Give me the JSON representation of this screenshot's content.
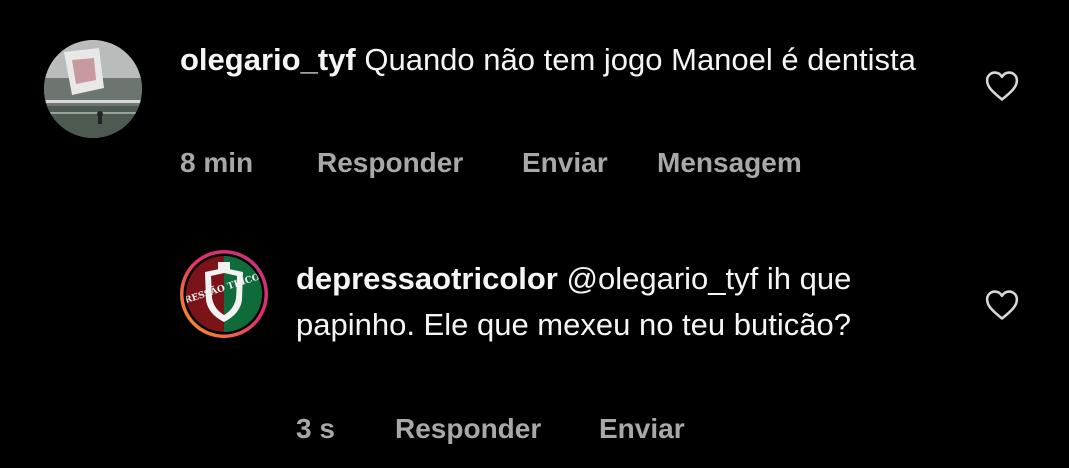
{
  "comments": [
    {
      "username": "olegario_tyf",
      "text": "Quando não tem jogo Manoel é dentista",
      "time": "8 min",
      "reply": "Responder",
      "send": "Enviar",
      "message": "Mensagem",
      "avatar_icon": "stadium-photo-avatar",
      "like_icon": "heart-outline-icon"
    },
    {
      "username": "depressaotricolor",
      "text": "@olegario_tyf ih que papinho. Ele que mexeu no teu buticão?",
      "time": "3 s",
      "reply": "Responder",
      "send": "Enviar",
      "avatar_icon": "depressao-tricolor-crest-avatar",
      "avatar_text": "DEPRESSÃO TRICOLOR",
      "story_ring_colors": [
        "#f9a31b",
        "#e1306c",
        "#c13584"
      ],
      "like_icon": "heart-outline-icon"
    }
  ]
}
